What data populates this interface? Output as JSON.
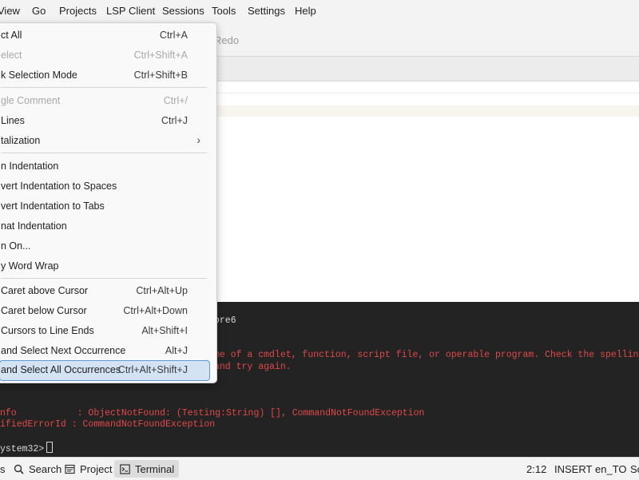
{
  "menubar": {
    "items": [
      "View",
      "Go",
      "Projects",
      "LSP Client",
      "Sessions",
      "Tools",
      "Settings",
      "Help"
    ]
  },
  "toolbar": {
    "redo_label": "Redo"
  },
  "menu": {
    "items": [
      {
        "label": "ct All",
        "shortcut": "Ctrl+A",
        "enabled": true
      },
      {
        "label": "elect",
        "shortcut": "Ctrl+Shift+A",
        "enabled": false
      },
      {
        "label": "k Selection Mode",
        "shortcut": "Ctrl+Shift+B",
        "enabled": true
      },
      {
        "label": "gle Comment",
        "shortcut": "Ctrl+/",
        "enabled": false
      },
      {
        "label": "Lines",
        "shortcut": "Ctrl+J",
        "enabled": true
      },
      {
        "label": "talization",
        "shortcut": "",
        "enabled": true,
        "submenu": true
      },
      {
        "label": "n Indentation",
        "shortcut": "",
        "enabled": true
      },
      {
        "label": "vert Indentation to Spaces",
        "shortcut": "",
        "enabled": true
      },
      {
        "label": "vert Indentation to Tabs",
        "shortcut": "",
        "enabled": true
      },
      {
        "label": "nat Indentation",
        "shortcut": "",
        "enabled": true
      },
      {
        "label": "n On...",
        "shortcut": "",
        "enabled": true
      },
      {
        "label": "y Word Wrap",
        "shortcut": "",
        "enabled": true
      },
      {
        "label": "Caret above Cursor",
        "shortcut": "Ctrl+Alt+Up",
        "enabled": true
      },
      {
        "label": "Caret below Cursor",
        "shortcut": "Ctrl+Alt+Down",
        "enabled": true
      },
      {
        "label": "Cursors to Line Ends",
        "shortcut": "Alt+Shift+I",
        "enabled": true
      },
      {
        "label": "and Select Next Occurrence",
        "shortcut": "Alt+J",
        "enabled": true
      },
      {
        "label": "and Select All Occurrences",
        "shortcut": "Ctrl+Alt+Shift+J",
        "enabled": true,
        "highlighted": true
      }
    ]
  },
  "terminal": {
    "lines": [
      {
        "text": "ore6",
        "color": "white"
      },
      {
        "text": "me of a cmdlet, function, script file, or operable program. Check the spelling",
        "color": "red"
      },
      {
        "text": "and try again.",
        "color": "red"
      },
      {
        "text": "nfo           : ObjectNotFound: (Testing:String) [], CommandNotFoundException",
        "color": "red"
      },
      {
        "text": "ifiedErrorId : CommandNotFoundException",
        "color": "red"
      },
      {
        "text": "ystem32>",
        "color": "white"
      }
    ]
  },
  "statusbar": {
    "tabs": [
      {
        "label": "s",
        "icon": "panel-icon"
      },
      {
        "label": "Search",
        "icon": "search-icon"
      },
      {
        "label": "Project",
        "icon": "project-icon"
      },
      {
        "label": "Terminal",
        "icon": "terminal-icon",
        "active": true
      }
    ],
    "position": "2:12",
    "mode": "INSERT",
    "language": "en_TO",
    "extra": "So"
  }
}
